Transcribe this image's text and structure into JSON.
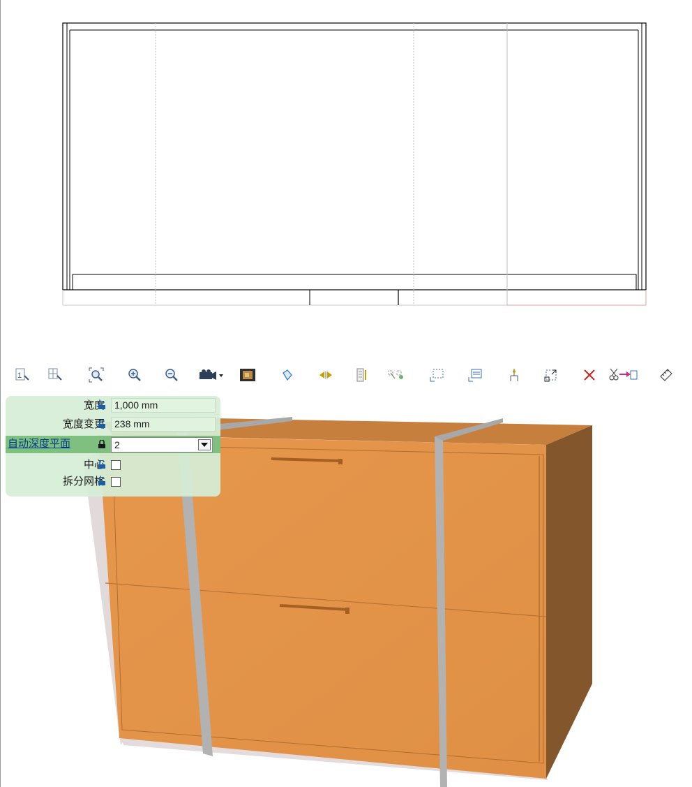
{
  "toolbar": {
    "buttons": [
      {
        "name": "view-1-icon",
        "label": "1"
      },
      {
        "name": "view-2-icon",
        "label": ""
      },
      {
        "name": "zoom-extents-icon",
        "label": ""
      },
      {
        "name": "zoom-in-icon",
        "label": ""
      },
      {
        "name": "zoom-out-icon",
        "label": ""
      },
      {
        "name": "camera-dropdown-icon",
        "label": ""
      },
      {
        "name": "film-render-icon",
        "label": ""
      },
      {
        "name": "rotate-object-icon",
        "label": ""
      },
      {
        "name": "flip-arrows-icon",
        "label": ""
      },
      {
        "name": "panel-layers-icon",
        "label": ""
      },
      {
        "name": "select-nodes-icon",
        "label": ""
      },
      {
        "name": "select-region-icon",
        "label": ""
      },
      {
        "name": "list-select-icon",
        "label": ""
      },
      {
        "name": "insert-point-icon",
        "label": ""
      },
      {
        "name": "resize-box-icon",
        "label": ""
      },
      {
        "name": "delete-icon",
        "label": ""
      },
      {
        "name": "cut-move-icon",
        "label": ""
      },
      {
        "name": "measure-ruler-icon",
        "label": ""
      }
    ]
  },
  "properties": {
    "width": {
      "label": "宽度",
      "value": "1,000 mm"
    },
    "width_change": {
      "label": "宽度变更",
      "value": "238 mm"
    },
    "auto_depth_plane": {
      "label": "自动深度平面",
      "value": "2"
    },
    "center": {
      "label": "中心"
    },
    "split_grid": {
      "label": "拆分网格"
    }
  },
  "colors": {
    "cabinet_front": "#e2954b",
    "cabinet_side": "#82562b",
    "strap": "#b4b4b4",
    "panel_bg": "#d6eed6",
    "active_row": "#7fbf7f"
  }
}
